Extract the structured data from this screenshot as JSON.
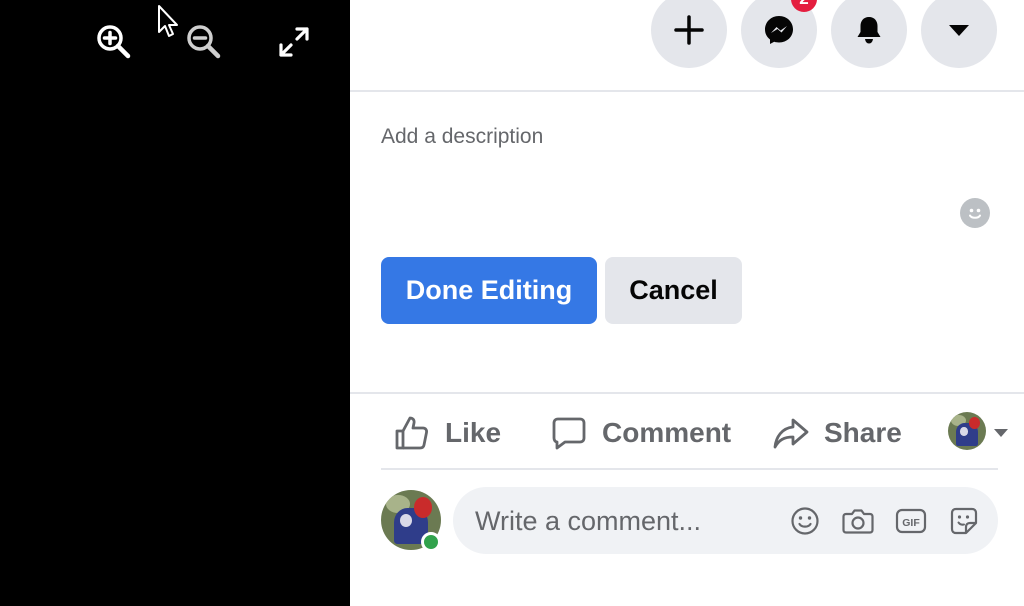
{
  "viewer": {
    "tools": [
      {
        "name": "zoom-in",
        "icon": "zoom-in-icon"
      },
      {
        "name": "zoom-out",
        "icon": "zoom-out-icon"
      },
      {
        "name": "fullscreen",
        "icon": "expand-icon"
      }
    ]
  },
  "header": {
    "buttons": [
      {
        "name": "create",
        "icon": "plus-icon"
      },
      {
        "name": "messenger",
        "icon": "messenger-icon",
        "badge": "2"
      },
      {
        "name": "notifications",
        "icon": "bell-icon"
      },
      {
        "name": "account",
        "icon": "caret-down-icon"
      }
    ]
  },
  "editor": {
    "description_placeholder": "Add a description",
    "done_label": "Done Editing",
    "cancel_label": "Cancel"
  },
  "actions": {
    "like_label": "Like",
    "comment_label": "Comment",
    "share_label": "Share"
  },
  "comment": {
    "placeholder": "Write a comment...",
    "icons": [
      "emoji-icon",
      "camera-icon",
      "gif-icon",
      "sticker-icon"
    ]
  },
  "colors": {
    "primary": "#3578e5",
    "button_gray": "#e4e6eb",
    "badge": "#e41e3f",
    "text_secondary": "#65676b",
    "online": "#31a24c"
  }
}
